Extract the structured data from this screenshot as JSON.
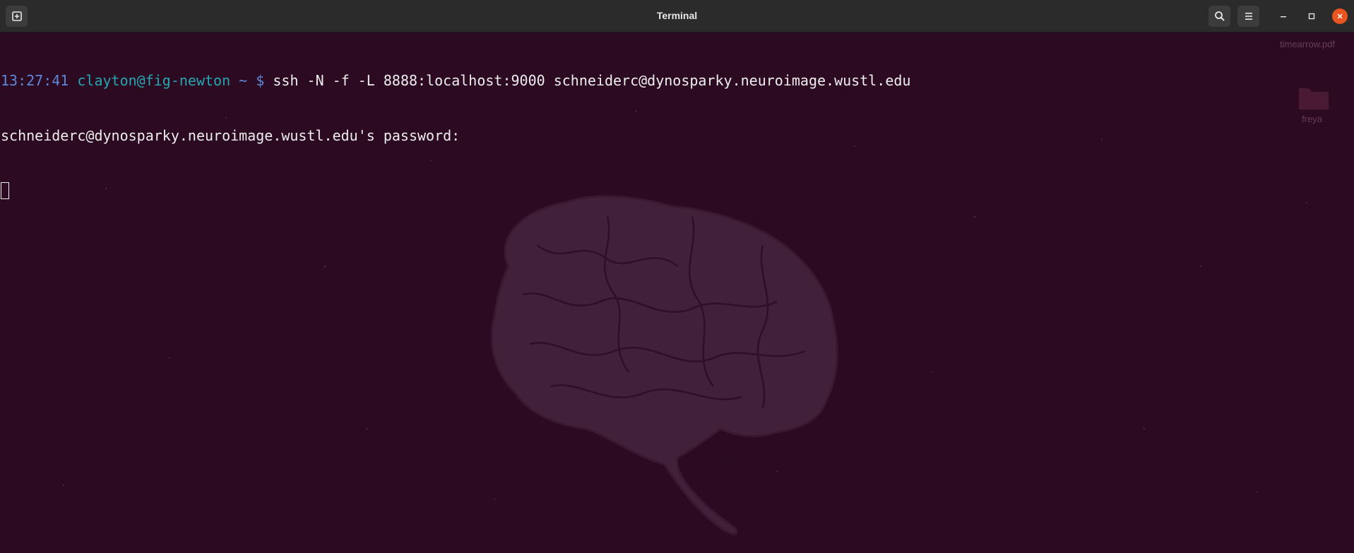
{
  "window": {
    "title": "Terminal"
  },
  "terminal": {
    "prompt": {
      "time": "13:27:41",
      "user_host": "clayton@fig-newton",
      "cwd": "~",
      "symbol": "$"
    },
    "command": "ssh -N -f -L 8888:localhost:9000 schneiderc@dynosparky.neuroimage.wustl.edu",
    "output_line": "schneiderc@dynosparky.neuroimage.wustl.edu's password:"
  },
  "desktop": {
    "icons": [
      {
        "label": "timearrow.pdf",
        "icon": "pdf-file-icon"
      },
      {
        "label": "freya",
        "icon": "folder-icon"
      }
    ]
  },
  "icons": {
    "new_tab": "new-tab-icon",
    "search": "search-icon",
    "menu": "hamburger-menu-icon",
    "minimize": "minimize-icon",
    "maximize": "maximize-icon",
    "close": "close-icon"
  },
  "colors": {
    "titlebar": "#2b2b2b",
    "terminal_bg": "#2c0b22",
    "prompt_time": "#5f87d7",
    "prompt_user": "#26a6b0",
    "text": "#eeeeee",
    "close_button": "#e95420"
  }
}
